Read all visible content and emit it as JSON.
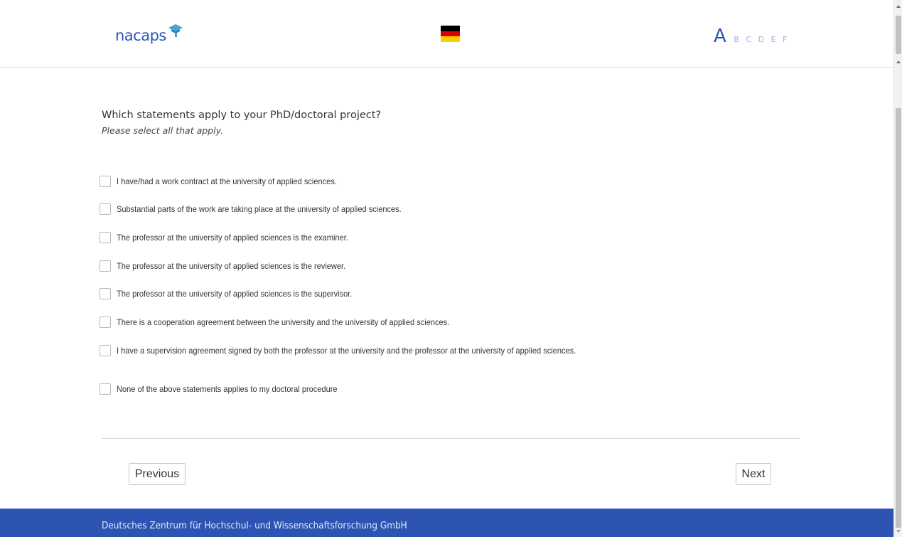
{
  "header": {
    "logo_text": "nacaps",
    "flag_colors": [
      "#000000",
      "#dd0000",
      "#ffce00"
    ],
    "steps": [
      {
        "label": "A",
        "active": true
      },
      {
        "label": "B",
        "active": false
      },
      {
        "label": "C",
        "active": false
      },
      {
        "label": "D",
        "active": false
      },
      {
        "label": "E",
        "active": false
      },
      {
        "label": "F",
        "active": false
      }
    ]
  },
  "question": {
    "title": "Which statements apply to your PhD/doctoral project?",
    "hint": "Please select all that apply."
  },
  "options": [
    {
      "label": "I have/had a work contract at the university of applied sciences.",
      "checked": false
    },
    {
      "label": "Substantial parts of the work are taking place at the university of applied sciences.",
      "checked": false
    },
    {
      "label": "The professor at the university of applied sciences is the examiner.",
      "checked": false
    },
    {
      "label": "The professor at the university of applied sciences is the reviewer.",
      "checked": false
    },
    {
      "label": "The professor at the university of applied sciences is the supervisor.",
      "checked": false
    },
    {
      "label": "There is a cooperation agreement between the university and the university of applied sciences.",
      "checked": false
    },
    {
      "label": "I have a supervision agreement signed by both the professor at the university and the professor at the university of applied sciences.",
      "checked": false
    },
    {
      "label": "None of the above statements applies to my doctoral procedure",
      "checked": false
    }
  ],
  "nav": {
    "previous_label": "Previous",
    "next_label": "Next"
  },
  "footer": {
    "text": "Deutsches Zentrum für Hochschul- und Wissenschaftsforschung GmbH"
  },
  "colors": {
    "brand_blue": "#2b56b5",
    "footer_blue": "#2d54b3",
    "step_inactive": "#9fb4dd"
  }
}
